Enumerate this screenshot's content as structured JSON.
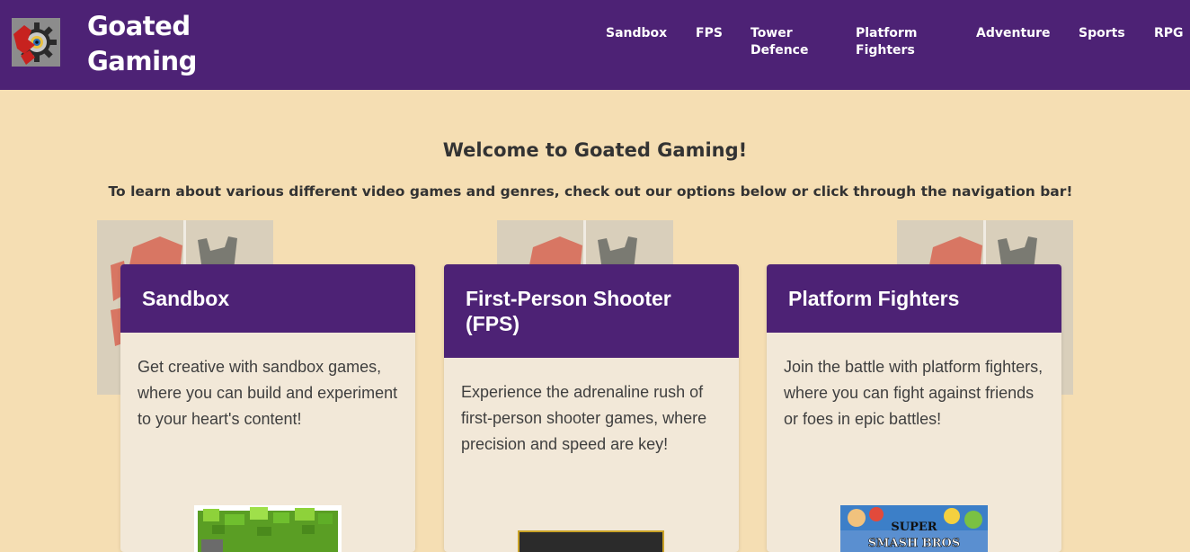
{
  "header": {
    "site_title": "Goated Gaming",
    "logo_icon": "gear-eye-logo-icon",
    "nav": [
      {
        "label": "Sandbox"
      },
      {
        "label": "FPS"
      },
      {
        "label": "Tower Defence"
      },
      {
        "label": "Platform Fighters"
      },
      {
        "label": "Adventure"
      },
      {
        "label": "Sports"
      },
      {
        "label": "RPG"
      }
    ]
  },
  "main": {
    "welcome": "Welcome to Goated Gaming!",
    "intro": "To learn about various different video games and genres, check out our options below or click through the navigation bar!",
    "cards": [
      {
        "title": "Sandbox",
        "text": "Get creative with sandbox games, where you can build and experiment to your heart's content!"
      },
      {
        "title": "First-Person Shooter (FPS)",
        "text": "Experience the adrenaline rush of first-person shooter games, where precision and speed are key!"
      },
      {
        "title": "Platform Fighters",
        "text": "Join the battle with platform fighters, where you can fight against friends or foes in epic battles!"
      }
    ],
    "thumb_text": {
      "fighters_top": "SUPER",
      "fighters_bottom": "SMASH BROS"
    }
  },
  "colors": {
    "nav_bg": "#4d2275",
    "page_bg": "#f5deb3",
    "card_bg": "#f2e8d8",
    "text_dark": "#333333"
  }
}
